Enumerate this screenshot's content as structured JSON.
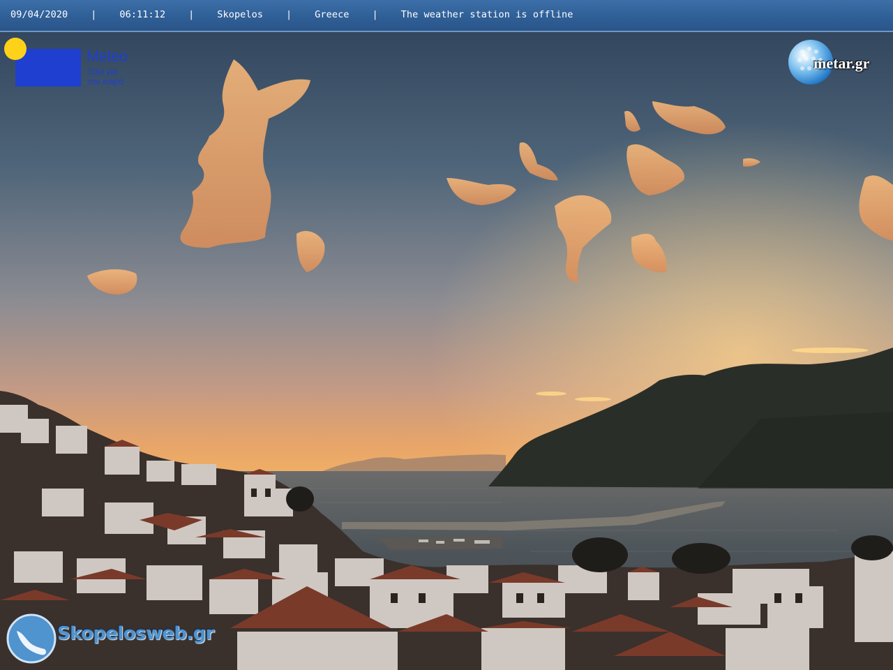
{
  "header": {
    "date": "09/04/2020",
    "time": "06:11:12",
    "place": "Skopelos",
    "country": "Greece",
    "status": "The weather station is offline",
    "separator": "|"
  },
  "logos": {
    "meteo": {
      "name": "Meteo",
      "tagline_line1": "Όλα για",
      "tagline_line2": "τον καιρό",
      "accent": "#1f3fd0",
      "sun_color": "#ffd21a"
    },
    "metar": {
      "text": "metar.gr"
    },
    "skopelosweb": {
      "text": "Skopelosweb.gr",
      "accent": "#4f93cf"
    }
  },
  "scene": {
    "description_icon": "webcam-harbor-sunrise-view",
    "colors": {
      "sky_top": "#33485e",
      "sky_mid": "#8e8b8c",
      "horizon": "#f2b066",
      "sea": "#3d4a52",
      "mountain": "#2b2f2a",
      "town": "#3a302c"
    }
  }
}
